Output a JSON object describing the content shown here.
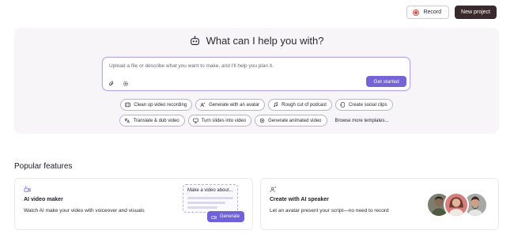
{
  "topbar": {
    "record_label": "Record",
    "new_project_label": "New project"
  },
  "hero": {
    "title": "What can I help you with?",
    "prompt_placeholder": "Upload a file or describe what you want to make, and I'll help you plan it.",
    "start_label": "Get started"
  },
  "chips": {
    "row1": [
      {
        "label": "Clean up video recording",
        "icon": "film-icon"
      },
      {
        "label": "Generate with an avatar",
        "icon": "avatar-sparkle-icon"
      },
      {
        "label": "Rough cut of podcast",
        "icon": "music-note-icon"
      },
      {
        "label": "Create social clips",
        "icon": "phone-icon"
      }
    ],
    "row2": [
      {
        "label": "Translate & dub video",
        "icon": "translate-icon"
      },
      {
        "label": "Turn slides into video",
        "icon": "slides-icon"
      },
      {
        "label": "Generate animated video",
        "icon": "animation-icon"
      }
    ],
    "more_label": "Browse more templates..."
  },
  "popular": {
    "title": "Popular features",
    "cards": [
      {
        "title": "AI video maker",
        "description": "Watch AI make your video with voiceover and visuals",
        "icon": "video-sparkle-icon",
        "mock_text": "Make a video about...",
        "mock_button": "Generate"
      },
      {
        "title": "Create with AI speaker",
        "description": "Let an avatar present your script—no need to record",
        "icon": "avatar-sparkle-icon"
      }
    ]
  },
  "colors": {
    "accent": "#7464d6",
    "record_red": "#e54848",
    "dark_button": "#3a2a2e",
    "hero_bg": "#f7f5f8"
  }
}
